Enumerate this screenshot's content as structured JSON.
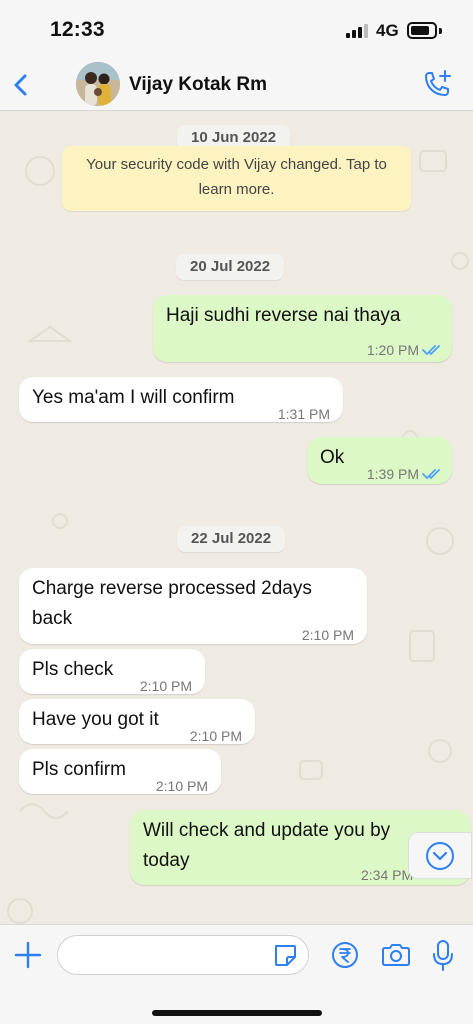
{
  "status_bar": {
    "time": "12:33",
    "network": "4G",
    "battery_level": 0.8
  },
  "header": {
    "back_icon": "chevron-left-icon",
    "contact_name": "Vijay Kotak Rm",
    "call_icon": "phone-plus-icon",
    "accent_color": "#2e7ff2"
  },
  "chat": {
    "date_1": "10 Jun 2022",
    "security_notice": "Your security code with Vijay changed. Tap to learn more.",
    "date_2": "20 Jul 2022",
    "date_3": "22 Jul 2022",
    "messages": [
      {
        "direction": "out",
        "text": "Haji sudhi reverse nai thaya",
        "time": "1:20 PM",
        "status": "read"
      },
      {
        "direction": "in",
        "text": "Yes ma'am I will confirm",
        "time": "1:31 PM"
      },
      {
        "direction": "out",
        "text": "Ok",
        "time": "1:39 PM",
        "status": "read"
      },
      {
        "direction": "in",
        "text_line1": "Charge reverse processed 2days",
        "text_line2": "back",
        "time": "2:10 PM"
      },
      {
        "direction": "in",
        "text": "Pls check",
        "time": "2:10 PM"
      },
      {
        "direction": "in",
        "text": "Have you got it",
        "time": "2:10 PM"
      },
      {
        "direction": "in",
        "text": "Pls confirm",
        "time": "2:10 PM"
      },
      {
        "direction": "out",
        "text_line1": "Will check and update you by",
        "text_line2": "today",
        "time": "2:34 PM"
      }
    ],
    "outgoing_bubble_color": "#dcf8c6",
    "incoming_bubble_color": "#ffffff",
    "read_tick_color": "#4fa3f7"
  },
  "input_bar": {
    "plus_icon": "plus-icon",
    "message_value": "",
    "sticker_icon": "sticker-icon",
    "rupee_icon": "rupee-payment-icon",
    "camera_icon": "camera-icon",
    "mic_icon": "microphone-icon"
  }
}
